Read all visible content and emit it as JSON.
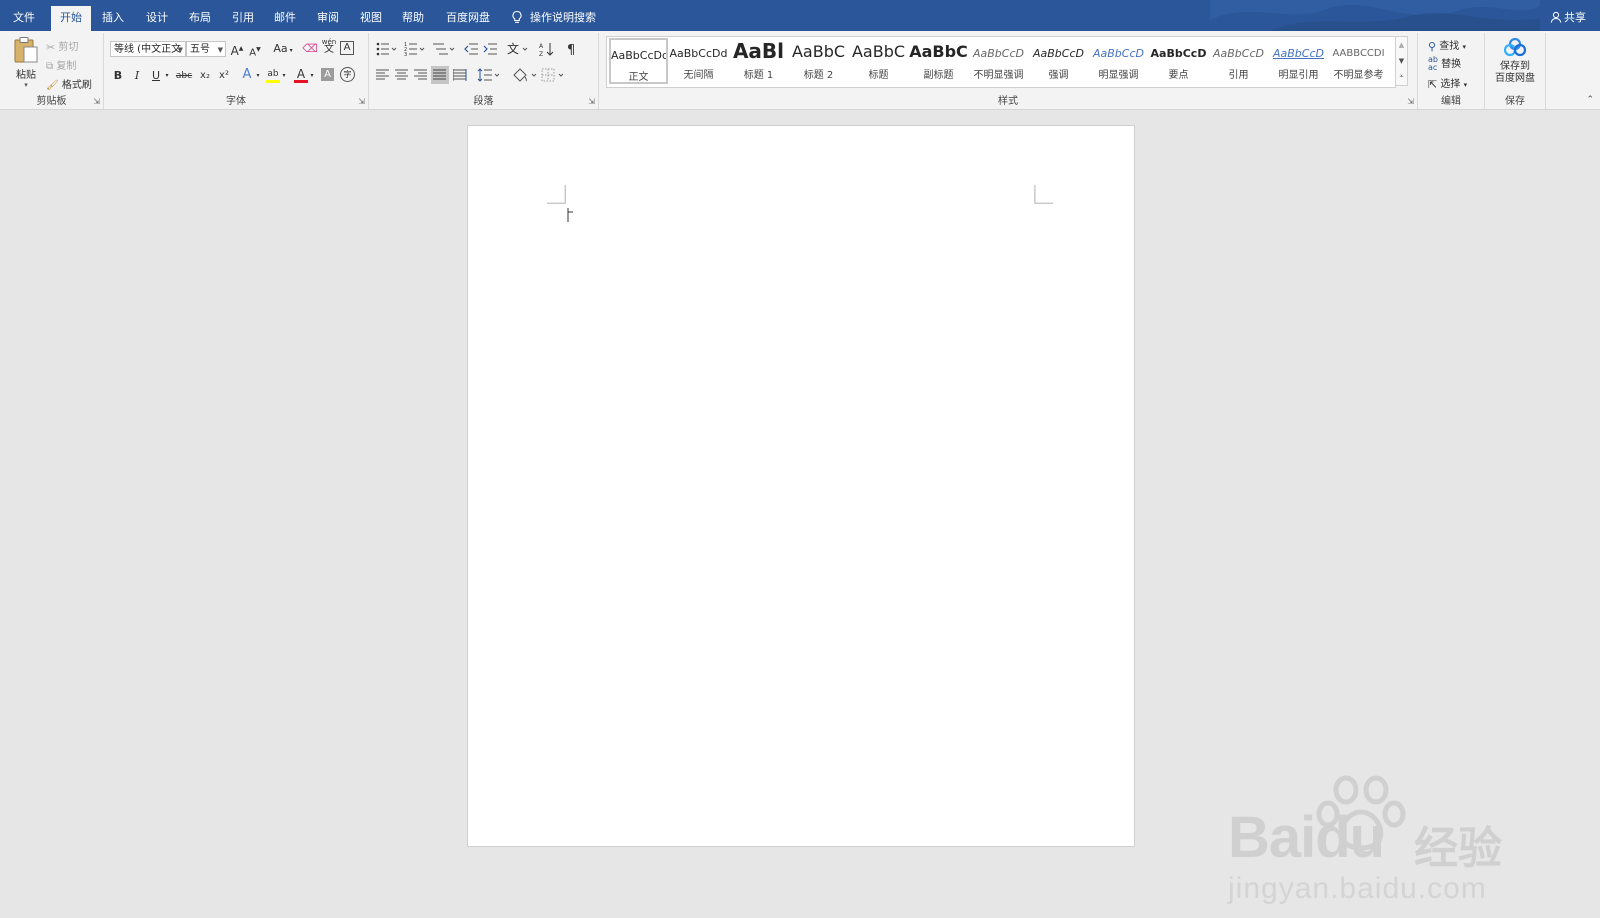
{
  "tabs": [
    {
      "label": "文件",
      "active": false
    },
    {
      "label": "开始",
      "active": true
    },
    {
      "label": "插入",
      "active": false
    },
    {
      "label": "设计",
      "active": false
    },
    {
      "label": "布局",
      "active": false
    },
    {
      "label": "引用",
      "active": false
    },
    {
      "label": "邮件",
      "active": false
    },
    {
      "label": "审阅",
      "active": false
    },
    {
      "label": "视图",
      "active": false
    },
    {
      "label": "帮助",
      "active": false
    },
    {
      "label": "百度网盘",
      "active": false
    }
  ],
  "tell_me": "操作说明搜索",
  "share": "共享",
  "clipboard": {
    "label": "剪贴板",
    "paste": "粘贴",
    "cut": "剪切",
    "copy": "复制",
    "format_painter": "格式刷"
  },
  "font": {
    "label": "字体",
    "font_name": "等线 (中文正文",
    "font_size": "五号",
    "bold": "B",
    "italic": "I",
    "underline": "U",
    "strike": "abc",
    "subscript": "x₂",
    "superscript": "x²",
    "change_case": "Aa",
    "grow": "A",
    "shrink": "A",
    "phonetic": "wén",
    "phonetic_char": "文",
    "char_border": "A",
    "text_effect": "A",
    "highlight": "ab",
    "font_color": "A",
    "shading": "A",
    "enclose": "字"
  },
  "paragraph": {
    "label": "段落"
  },
  "styles": {
    "label": "样式",
    "items": [
      {
        "sample": "AaBbCcDd",
        "name": "正文",
        "selected": true
      },
      {
        "sample": "AaBbCcDd",
        "name": "无间隔",
        "selected": false
      },
      {
        "sample": "AaBl",
        "name": "标题 1",
        "selected": false
      },
      {
        "sample": "AaBbC",
        "name": "标题 2",
        "selected": false
      },
      {
        "sample": "AaBbC",
        "name": "标题",
        "selected": false
      },
      {
        "sample": "AaBbC",
        "name": "副标题",
        "selected": false
      },
      {
        "sample": "AaBbCcD",
        "name": "不明显强调",
        "selected": false
      },
      {
        "sample": "AaBbCcD",
        "name": "强调",
        "selected": false
      },
      {
        "sample": "AaBbCcD",
        "name": "明显强调",
        "selected": false
      },
      {
        "sample": "AaBbCcD",
        "name": "要点",
        "selected": false
      },
      {
        "sample": "AaBbCcD",
        "name": "引用",
        "selected": false
      },
      {
        "sample": "AaBbCcD",
        "name": "明显引用",
        "selected": false
      },
      {
        "sample": "AABBCCDI",
        "name": "不明显参考",
        "selected": false
      }
    ]
  },
  "editing": {
    "label": "编辑",
    "find": "查找",
    "replace": "替换",
    "select": "选择"
  },
  "save": {
    "label": "保存",
    "button_line1": "保存到",
    "button_line2": "百度网盘"
  },
  "watermark": {
    "brand": "Baidu",
    "brand_cn": "经验",
    "url": "jingyan.baidu.com"
  },
  "colors": {
    "tab_bar": "#2b579a",
    "ribbon": "#f3f3f3",
    "canvas": "#e6e6e6",
    "page": "#ffffff",
    "highlight_yellow": "#ffff00",
    "font_red": "#e81123"
  }
}
